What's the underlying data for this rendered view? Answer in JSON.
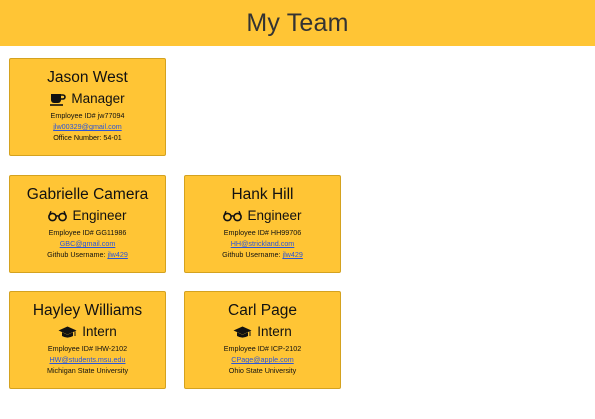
{
  "page": {
    "title": "My Team"
  },
  "cards": [
    {
      "name": "Jason West",
      "role": "Manager",
      "icon": "coffee-cup-icon",
      "id_text": "Employee ID# jw77094",
      "email": "jlw00329@gmail.com",
      "extra_label": "Office Number: 54-01",
      "extra_link": ""
    },
    {
      "name": "Gabrielle Camera",
      "role": "Engineer",
      "icon": "glasses-icon",
      "id_text": "Employee ID# GG11986",
      "email": "GBC@gmail.com",
      "extra_label": "Github Username: ",
      "extra_link": "jlw429"
    },
    {
      "name": "Hank Hill",
      "role": "Engineer",
      "icon": "glasses-icon",
      "id_text": "Employee ID# HH99706",
      "email": "HH@strickland.com",
      "extra_label": "Github Username: ",
      "extra_link": "jlw429"
    },
    {
      "name": "Hayley Williams",
      "role": "Intern",
      "icon": "graduation-cap-icon",
      "id_text": "Employee ID# IHW-2102",
      "email": "HW@students.msu.edu",
      "extra_label": "Michigan State University",
      "extra_link": ""
    },
    {
      "name": "Carl Page",
      "role": "Intern",
      "icon": "graduation-cap-icon",
      "id_text": "Employee ID# ICP-2102",
      "email": "CPage@apple.com",
      "extra_label": "Ohio State University",
      "extra_link": ""
    }
  ],
  "colors": {
    "header_bg": "#ffc535",
    "card_bg": "#ffc535",
    "link": "#2b55d9"
  }
}
